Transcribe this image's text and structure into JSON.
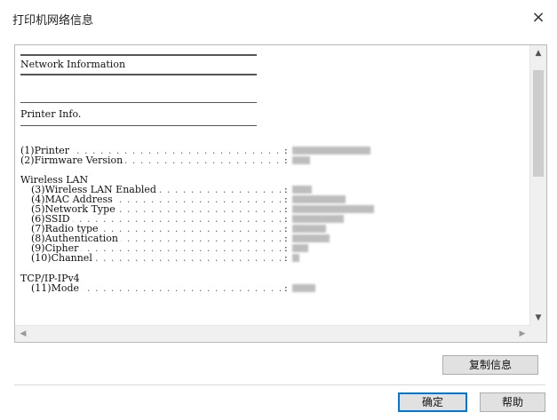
{
  "window": {
    "title": "打印机网络信息",
    "close_glyph": "×"
  },
  "report": {
    "network_heading": "Network Information",
    "printer_heading": "Printer Info.",
    "printer_rows": [
      {
        "label": "(1)Printer"
      },
      {
        "label": "(2)Firmware Version"
      }
    ],
    "wireless_heading": "Wireless LAN",
    "wireless_rows": [
      {
        "label": "(3)Wireless LAN Enabled"
      },
      {
        "label": "(4)MAC Address"
      },
      {
        "label": "(5)Network Type"
      },
      {
        "label": "(6)SSID"
      },
      {
        "label": "(7)Radio type"
      },
      {
        "label": "(8)Authentication"
      },
      {
        "label": "(9)Cipher"
      },
      {
        "label": "(10)Channel"
      }
    ],
    "tcp_heading": "TCP/IP-IPv4",
    "tcp_rows": [
      {
        "label": "(11)Mode"
      }
    ],
    "colon": ":",
    "dots": ". . . . . . . . . . . . . . . . . . . . . . . . . . . . . . . . . . . . . . . ."
  },
  "buttons": {
    "copy_label": "复制信息",
    "ok_label": "确定",
    "help_label": "帮助"
  },
  "scroll": {
    "up": "▲",
    "down": "▼",
    "left": "◀",
    "right": "▶"
  }
}
